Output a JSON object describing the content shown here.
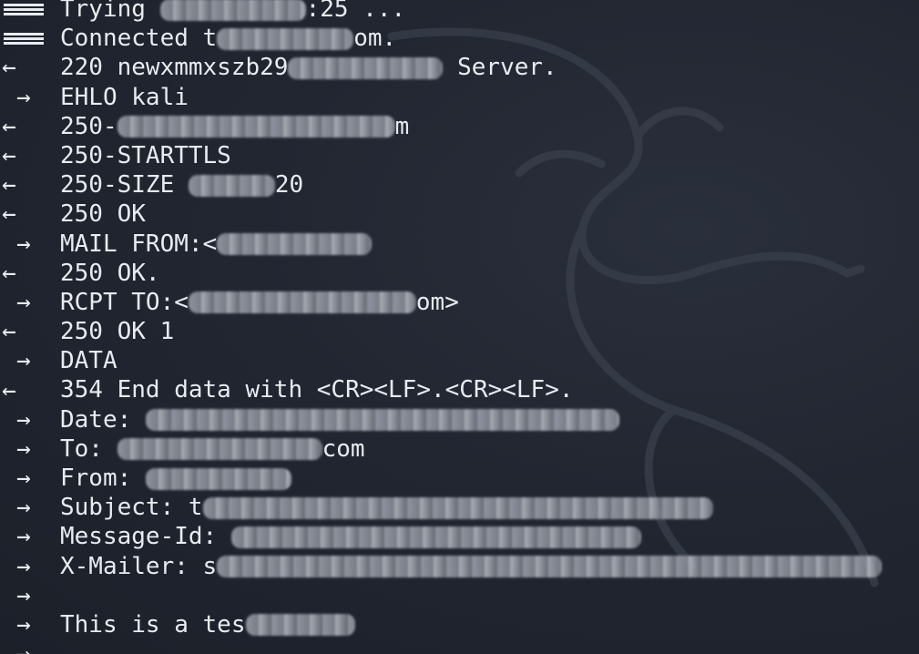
{
  "terminal": {
    "lines": [
      {
        "dir": "conn",
        "before": "Trying ",
        "redacted": true,
        "after": ":25 ..."
      },
      {
        "dir": "conn",
        "before": "Connected t",
        "redacted": true,
        "after": "om."
      },
      {
        "dir": "in",
        "before": "220 newxmmxszb29",
        "redacted": true,
        "after": " Server."
      },
      {
        "dir": "out",
        "before": "EHLO kali",
        "redacted": false,
        "after": ""
      },
      {
        "dir": "in",
        "before": "250-",
        "redacted": true,
        "after": "m"
      },
      {
        "dir": "in",
        "before": "250-STARTTLS",
        "redacted": false,
        "after": ""
      },
      {
        "dir": "in",
        "before": "250-SIZE ",
        "redacted": true,
        "after": "20"
      },
      {
        "dir": "in",
        "before": "250 OK",
        "redacted": false,
        "after": ""
      },
      {
        "dir": "out",
        "before": "MAIL FROM:<",
        "redacted": true,
        "after": ""
      },
      {
        "dir": "in",
        "before": "250 OK.",
        "redacted": false,
        "after": ""
      },
      {
        "dir": "out",
        "before": "RCPT TO:<",
        "redacted": true,
        "after": "om>"
      },
      {
        "dir": "in",
        "before": "250 OK 1",
        "redacted": false,
        "after": ""
      },
      {
        "dir": "out",
        "before": "DATA",
        "redacted": false,
        "after": ""
      },
      {
        "dir": "in",
        "before": "354 End data with <CR><LF>.<CR><LF>.",
        "redacted": false,
        "after": ""
      },
      {
        "dir": "out",
        "before": "Date: ",
        "redacted": true,
        "after": ""
      },
      {
        "dir": "out",
        "before": "To: ",
        "redacted": true,
        "after": "com"
      },
      {
        "dir": "out",
        "before": "From: ",
        "redacted": true,
        "after": ""
      },
      {
        "dir": "out",
        "before": "Subject: t",
        "redacted": true,
        "after": ""
      },
      {
        "dir": "out",
        "before": "Message-Id: ",
        "redacted": true,
        "after": ""
      },
      {
        "dir": "out",
        "before": "X-Mailer: s",
        "redacted": true,
        "after": ""
      },
      {
        "dir": "out",
        "before": "",
        "redacted": false,
        "after": ""
      },
      {
        "dir": "out",
        "before": "This is a tes",
        "redacted": true,
        "after": ""
      },
      {
        "dir": "out",
        "before": "",
        "redacted": false,
        "after": ""
      }
    ],
    "glyphs": {
      "in": "←",
      "out": "→"
    }
  },
  "colors": {
    "background": "#20242f",
    "text": "#e8ebf0",
    "watermark": "#3a3f4c"
  }
}
